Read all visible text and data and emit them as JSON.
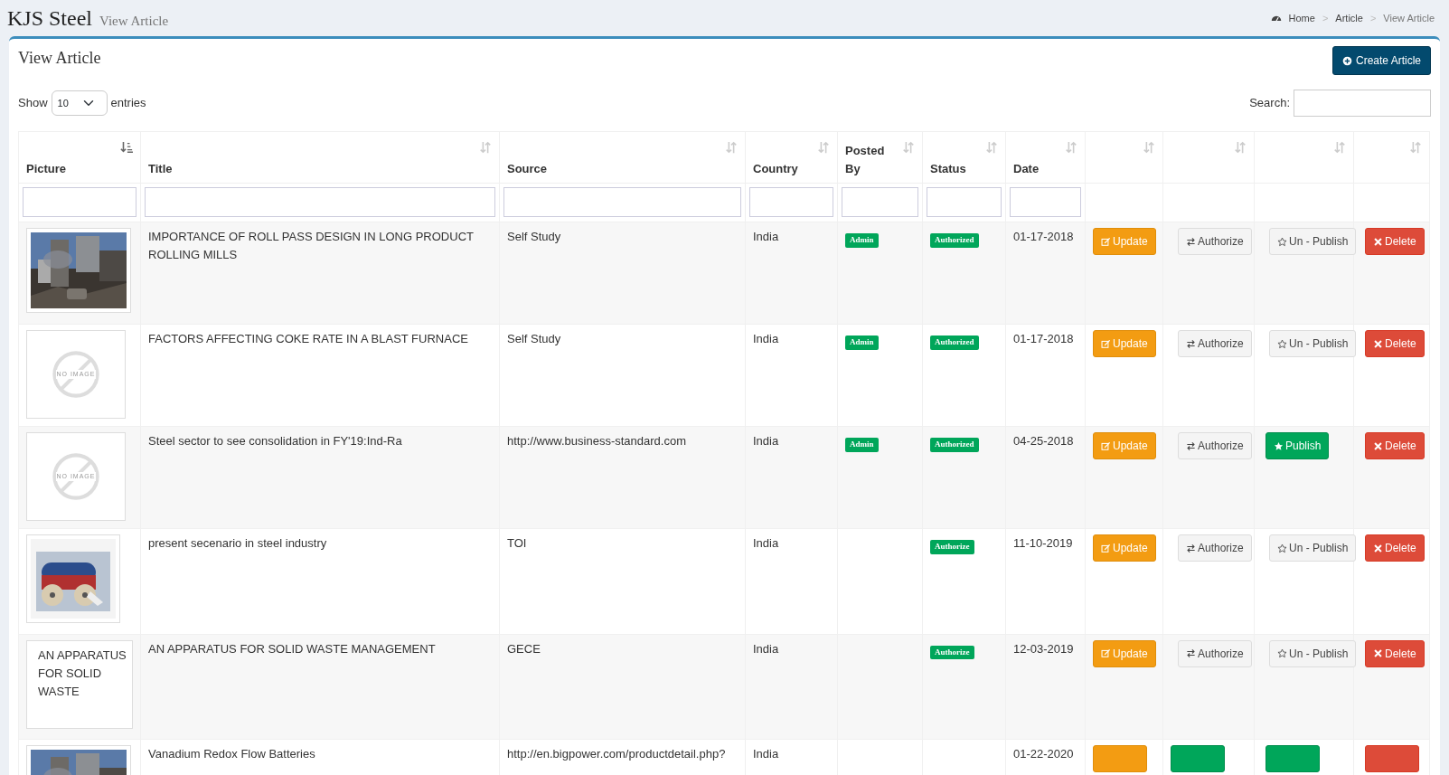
{
  "header": {
    "title": "KJS Steel",
    "subtitle": "View Article"
  },
  "breadcrumb": {
    "separator": ">",
    "items": [
      {
        "label": "Home",
        "active": false
      },
      {
        "label": "Article",
        "active": false
      },
      {
        "label": "View Article",
        "active": true
      }
    ]
  },
  "box": {
    "title": "View Article",
    "create_button": "Create Article"
  },
  "length_menu": {
    "show_label": "Show",
    "value": "10",
    "entries_label": "entries"
  },
  "search": {
    "label": "Search:"
  },
  "table": {
    "columns": [
      {
        "label": "Picture",
        "sorted": true,
        "filter": true
      },
      {
        "label": "Title",
        "sorted": false,
        "filter": true
      },
      {
        "label": "Source",
        "sorted": false,
        "filter": true
      },
      {
        "label": "Country",
        "sorted": false,
        "filter": true
      },
      {
        "label": "Posted By",
        "sorted": false,
        "filter": true
      },
      {
        "label": "Status",
        "sorted": false,
        "filter": true
      },
      {
        "label": "Date",
        "sorted": false,
        "filter": true
      },
      {
        "sorted": false,
        "filter": false
      },
      {
        "sorted": false,
        "filter": false
      },
      {
        "sorted": false,
        "filter": false
      },
      {
        "sorted": false,
        "filter": false
      }
    ],
    "rows": [
      {
        "title": "IMPORTANCE OF ROLL PASS DESIGN IN LONG PRODUCT ROLLING MILLS",
        "source": "Self Study",
        "country": "India",
        "posted_by": "Admin",
        "status": "Authorized",
        "date": "01-17-2018",
        "buttons": [
          {
            "kind": "update",
            "label": "Update"
          },
          {
            "kind": "authorize",
            "label": "Authorize"
          },
          {
            "kind": "unpublish",
            "label": "Un - Publish"
          },
          {
            "kind": "delete",
            "label": "Delete"
          }
        ]
      },
      {
        "picture": {
          "kind": "no_image",
          "label": "NO IMAGE"
        },
        "title": "FACTORS AFFECTING COKE RATE IN A BLAST FURNACE",
        "source": "Self Study",
        "country": "India",
        "posted_by": "Admin",
        "status": "Authorized",
        "date": "01-17-2018",
        "buttons": [
          {
            "kind": "update",
            "label": "Update"
          },
          {
            "kind": "authorize",
            "label": "Authorize"
          },
          {
            "kind": "unpublish",
            "label": "Un - Publish"
          },
          {
            "kind": "delete",
            "label": "Delete"
          }
        ]
      },
      {
        "picture": {
          "kind": "no_image",
          "label": "NO IMAGE"
        },
        "title": "Steel sector to see consolidation in FY'19:Ind-Ra",
        "source": "http://www.business-standard.com",
        "country": "India",
        "posted_by": "Admin",
        "status": "Authorized",
        "date": "04-25-2018",
        "buttons": [
          {
            "kind": "update",
            "label": "Update"
          },
          {
            "kind": "authorize",
            "label": "Authorize"
          },
          {
            "kind": "publish",
            "label": "Publish"
          },
          {
            "kind": "delete",
            "label": "Delete"
          }
        ]
      },
      {
        "picture": {
          "kind": "diagram"
        },
        "title": "present secenario in steel industry",
        "source": "TOI",
        "country": "India",
        "status": "Authorize",
        "date": "11-10-2019",
        "buttons": [
          {
            "kind": "update",
            "label": "Update"
          },
          {
            "kind": "authorize",
            "label": "Authorize"
          },
          {
            "kind": "unpublish",
            "label": "Un - Publish"
          },
          {
            "kind": "delete",
            "label": "Delete"
          }
        ]
      },
      {
        "picture": {
          "kind": "broken",
          "alt": "AN APPARATUS FOR SOLID WASTE"
        },
        "title": "AN APPARATUS FOR SOLID WASTE MANAGEMENT",
        "source": "GECE",
        "country": "India",
        "status": "Authorize",
        "date": "12-03-2019",
        "buttons": [
          {
            "kind": "update",
            "label": "Update"
          },
          {
            "kind": "authorize",
            "label": "Authorize"
          },
          {
            "kind": "unpublish",
            "label": "Un - Publish"
          },
          {
            "kind": "delete",
            "label": "Delete"
          }
        ]
      },
      {
        "title": "Vanadium Redox Flow Batteries",
        "source": "http://en.bigpower.com/productdetail.php?",
        "country": "India",
        "date": "01-22-2020",
        "buttons": [
          {
            "kind": "update"
          },
          {
            "kind": "authorized"
          },
          {
            "kind": "publish"
          },
          {
            "kind": "delete"
          }
        ]
      }
    ]
  }
}
